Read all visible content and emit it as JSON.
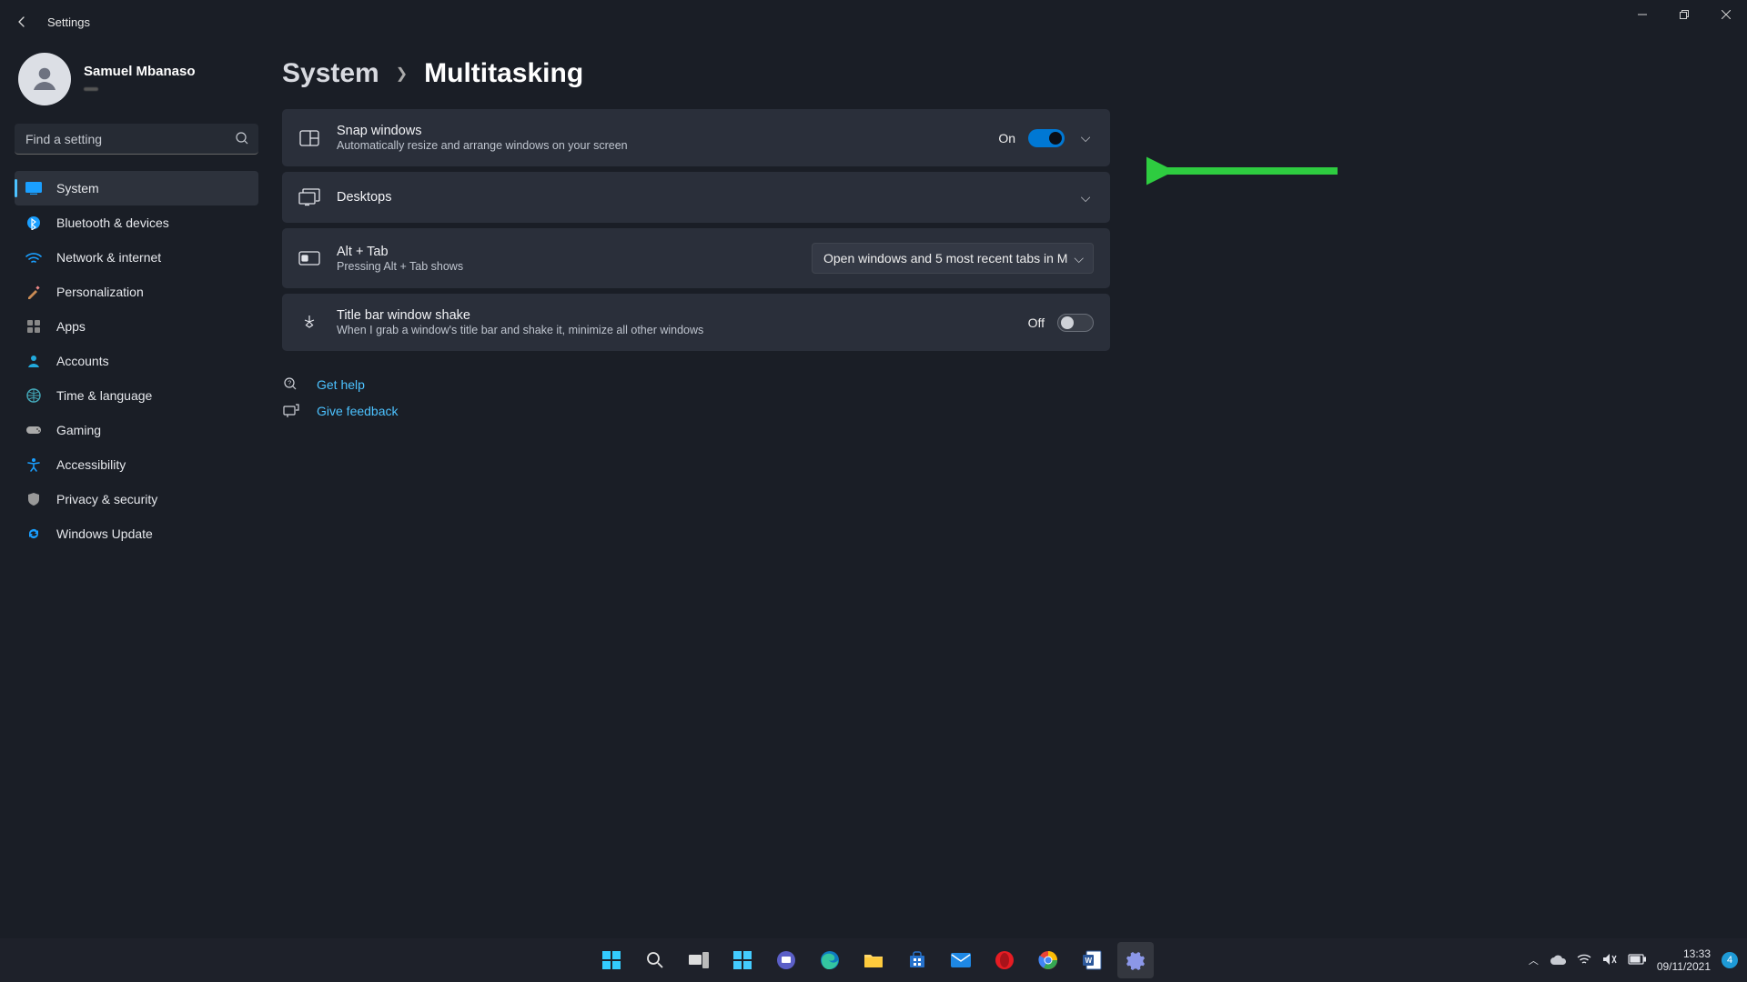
{
  "window": {
    "title": "Settings"
  },
  "user": {
    "name": "Samuel Mbanaso",
    "email_masked": "                          "
  },
  "search": {
    "placeholder": "Find a setting"
  },
  "sidebar": {
    "items": [
      {
        "label": "System"
      },
      {
        "label": "Bluetooth & devices"
      },
      {
        "label": "Network & internet"
      },
      {
        "label": "Personalization"
      },
      {
        "label": "Apps"
      },
      {
        "label": "Accounts"
      },
      {
        "label": "Time & language"
      },
      {
        "label": "Gaming"
      },
      {
        "label": "Accessibility"
      },
      {
        "label": "Privacy & security"
      },
      {
        "label": "Windows Update"
      }
    ]
  },
  "breadcrumb": {
    "root": "System",
    "leaf": "Multitasking"
  },
  "settings": {
    "snap": {
      "title": "Snap windows",
      "desc": "Automatically resize and arrange windows on your screen",
      "state": "On"
    },
    "desktops": {
      "title": "Desktops"
    },
    "alttab": {
      "title": "Alt + Tab",
      "desc": "Pressing Alt + Tab shows",
      "value": "Open windows and 5 most recent tabs in M"
    },
    "shake": {
      "title": "Title bar window shake",
      "desc": "When I grab a window's title bar and shake it, minimize all other windows",
      "state": "Off"
    }
  },
  "help": {
    "get_help": "Get help",
    "feedback": "Give feedback"
  },
  "tray": {
    "time": "13:33",
    "date": "09/11/2021",
    "badge": "4"
  }
}
